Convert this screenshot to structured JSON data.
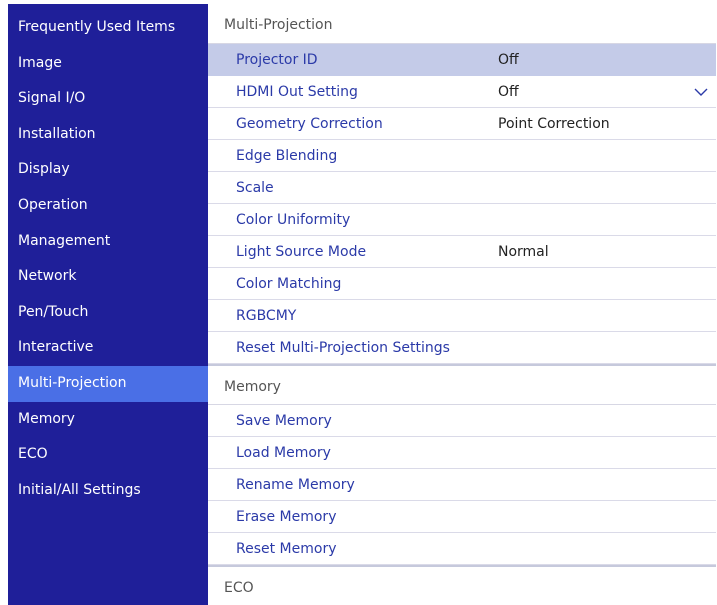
{
  "sidebar": {
    "items": [
      {
        "label": "Frequently Used Items"
      },
      {
        "label": "Image"
      },
      {
        "label": "Signal I/O"
      },
      {
        "label": "Installation"
      },
      {
        "label": "Display"
      },
      {
        "label": "Operation"
      },
      {
        "label": "Management"
      },
      {
        "label": "Network"
      },
      {
        "label": "Pen/Touch"
      },
      {
        "label": "Interactive"
      },
      {
        "label": "Multi-Projection"
      },
      {
        "label": "Memory"
      },
      {
        "label": "ECO"
      },
      {
        "label": "Initial/All Settings"
      }
    ],
    "active": "Multi-Projection"
  },
  "sections": [
    {
      "title": "Multi-Projection",
      "rows": [
        {
          "label": "Projector ID",
          "value": "Off"
        },
        {
          "label": "HDMI Out Setting",
          "value": "Off"
        },
        {
          "label": "Geometry Correction",
          "value": "Point Correction"
        },
        {
          "label": "Edge Blending",
          "value": ""
        },
        {
          "label": "Scale",
          "value": ""
        },
        {
          "label": "Color Uniformity",
          "value": ""
        },
        {
          "label": "Light Source Mode",
          "value": "Normal"
        },
        {
          "label": "Color Matching",
          "value": ""
        },
        {
          "label": "RGBCMY",
          "value": ""
        },
        {
          "label": "Reset Multi-Projection Settings",
          "value": ""
        }
      ]
    },
    {
      "title": "Memory",
      "rows": [
        {
          "label": "Save Memory",
          "value": ""
        },
        {
          "label": "Load Memory",
          "value": ""
        },
        {
          "label": "Rename Memory",
          "value": ""
        },
        {
          "label": "Erase Memory",
          "value": ""
        },
        {
          "label": "Reset Memory",
          "value": ""
        }
      ]
    },
    {
      "title": "ECO",
      "rows": []
    }
  ],
  "colors": {
    "sidebar_bg": "#1f1f99",
    "sidebar_active": "#4a6fe6",
    "row_selected": "#c4cbe8",
    "item_text": "#2b3aa8"
  },
  "icons": {
    "dropdown": "chevron-down-icon"
  }
}
